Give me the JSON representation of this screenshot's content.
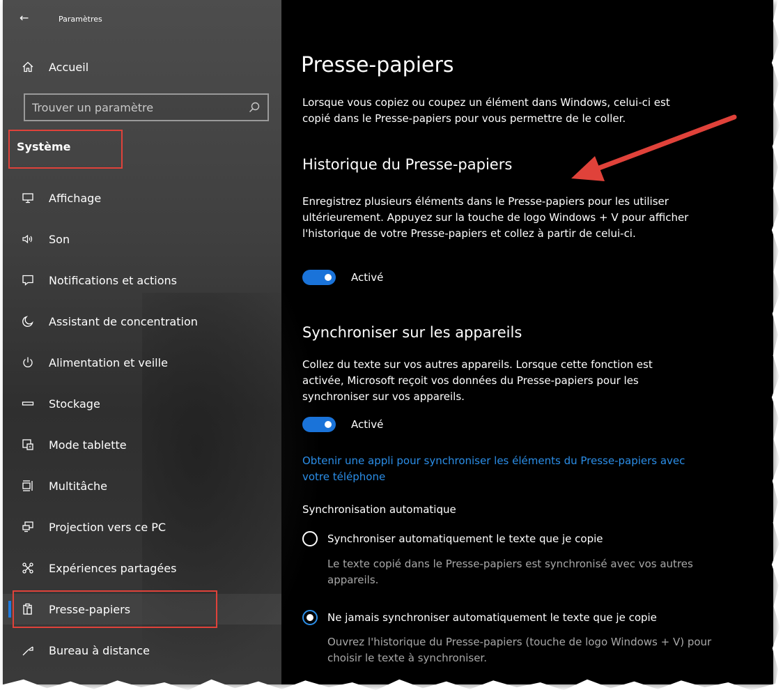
{
  "window": {
    "title": "Paramètres"
  },
  "sidebar": {
    "home_label": "Accueil",
    "search_placeholder": "Trouver un paramètre",
    "section_label": "Système",
    "items": [
      {
        "label": "Affichage",
        "icon": "monitor-icon"
      },
      {
        "label": "Son",
        "icon": "speaker-icon"
      },
      {
        "label": "Notifications et actions",
        "icon": "notification-icon"
      },
      {
        "label": "Assistant de concentration",
        "icon": "moon-icon"
      },
      {
        "label": "Alimentation et veille",
        "icon": "power-icon"
      },
      {
        "label": "Stockage",
        "icon": "storage-icon"
      },
      {
        "label": "Mode tablette",
        "icon": "tablet-icon"
      },
      {
        "label": "Multitâche",
        "icon": "multitask-icon"
      },
      {
        "label": "Projection vers ce PC",
        "icon": "projection-icon"
      },
      {
        "label": "Expériences partagées",
        "icon": "shared-icon"
      },
      {
        "label": "Presse-papiers",
        "icon": "clipboard-icon",
        "selected": true
      },
      {
        "label": "Bureau à distance",
        "icon": "remote-desktop-icon"
      }
    ]
  },
  "main": {
    "title": "Presse-papiers",
    "intro": "Lorsque vous copiez ou coupez un élément dans Windows, celui-ci est copié dans le Presse-papiers pour vous permettre de le coller.",
    "history": {
      "heading": "Historique du Presse-papiers",
      "description": "Enregistrez plusieurs éléments dans le Presse-papiers pour les utiliser ultérieurement. Appuyez sur la touche de logo Windows + V pour afficher l'historique de votre Presse-papiers et collez à partir de celui-ci.",
      "toggle_label": "Activé",
      "toggle_on": true
    },
    "sync": {
      "heading": "Synchroniser sur les appareils",
      "description": "Collez du texte sur vos autres appareils. Lorsque cette fonction est activée, Microsoft reçoit vos données du Presse-papiers pour les synchroniser sur vos appareils.",
      "toggle_label": "Activé",
      "toggle_on": true,
      "link": "Obtenir une appli pour synchroniser les éléments du Presse-papiers avec votre téléphone",
      "auto_sync_label": "Synchronisation automatique",
      "options": [
        {
          "label": "Synchroniser automatiquement le texte que je copie",
          "description": "Le texte copié dans le Presse-papiers est synchronisé avec vos autres appareils.",
          "checked": false
        },
        {
          "label": "Ne jamais synchroniser automatiquement le texte que je copie",
          "description": "Ouvrez l'historique du Presse-papiers (touche de logo Windows + V) pour choisir le texte à synchroniser.",
          "checked": true
        }
      ]
    }
  },
  "colors": {
    "accent": "#1a73d9",
    "link": "#2b8ee8",
    "highlight_box": "#e0423a",
    "annotation_arrow": "#e0423a"
  }
}
